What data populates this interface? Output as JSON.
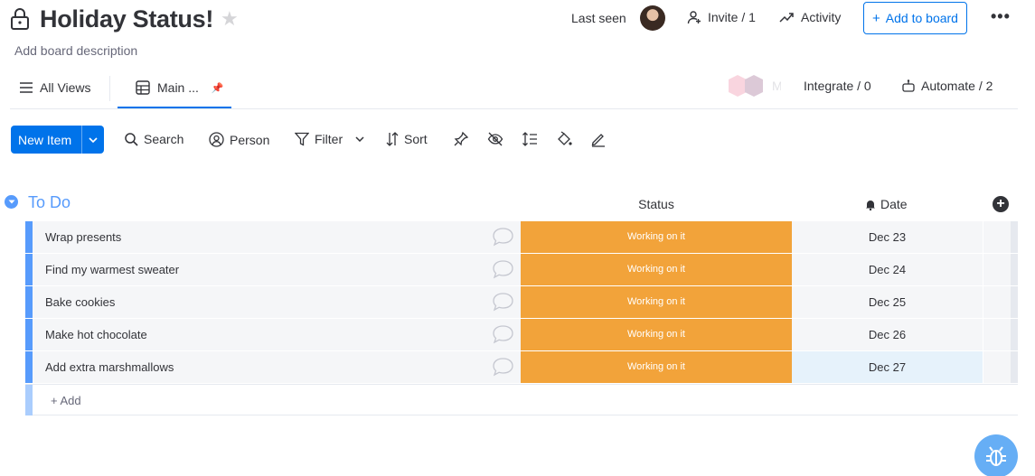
{
  "header": {
    "title": "Holiday Status!",
    "description": "Add board description",
    "last_seen_label": "Last seen",
    "invite_label": "Invite / 1",
    "activity_label": "Activity",
    "add_to_board_label": "Add to board",
    "more_label": "•••"
  },
  "views": {
    "all_views_label": "All Views",
    "main_tab_label": "Main ...",
    "integrate_label": "Integrate / 0",
    "automate_label": "Automate / 2"
  },
  "toolbar": {
    "new_item_label": "New Item",
    "search_label": "Search",
    "person_label": "Person",
    "filter_label": "Filter",
    "sort_label": "Sort"
  },
  "group": {
    "title": "To Do",
    "columns": {
      "status": "Status",
      "date": "Date"
    },
    "rows": [
      {
        "name": "Wrap presents",
        "status": "Working on it",
        "date": "Dec 23"
      },
      {
        "name": "Find my warmest sweater",
        "status": "Working on it",
        "date": "Dec 24"
      },
      {
        "name": "Bake cookies",
        "status": "Working on it",
        "date": "Dec 25"
      },
      {
        "name": "Make hot chocolate",
        "status": "Working on it",
        "date": "Dec 26"
      },
      {
        "name": "Add extra marshmallows",
        "status": "Working on it",
        "date": "Dec 27"
      }
    ],
    "add_label": "+ Add"
  },
  "colors": {
    "accent": "#0073ea",
    "group": "#579bfc",
    "working_on_it": "#f2a33a"
  },
  "icons": [
    "lock-icon",
    "star-icon",
    "avatar",
    "invite-icon",
    "activity-icon",
    "more-icon",
    "menu-icon",
    "table-icon",
    "pin-icon",
    "automate-icon",
    "search-icon",
    "person-icon",
    "filter-icon",
    "sort-icon",
    "chevron-down-icon",
    "hide-icon",
    "row-height-icon",
    "color-icon",
    "edit-icon",
    "bell-icon",
    "plus-circle-icon",
    "comment-icon",
    "bug-icon"
  ]
}
